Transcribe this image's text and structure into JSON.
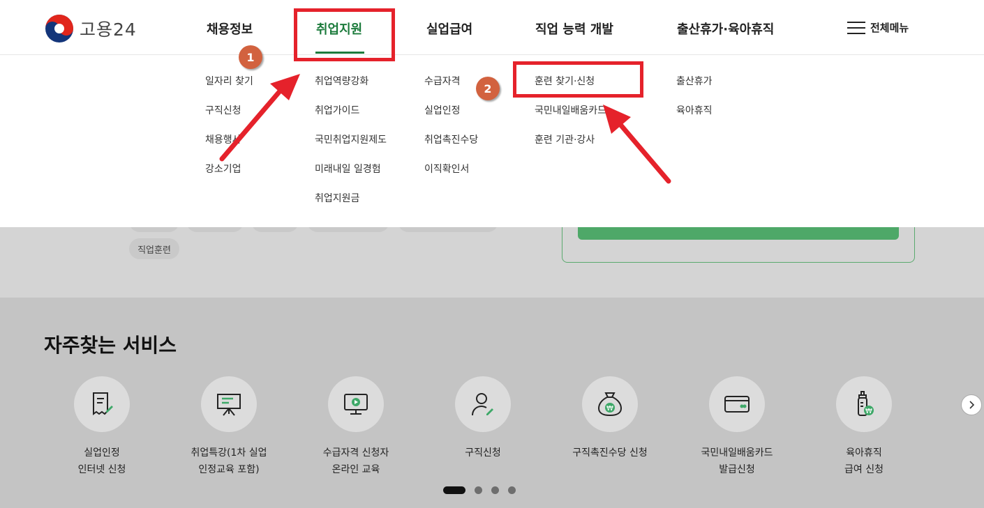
{
  "header": {
    "logo_text": "고용24",
    "gnb": [
      "채용정보",
      "취업지원",
      "실업급여",
      "직업 능력 개발",
      "출산휴가·육아휴직"
    ],
    "all_menu_label": "전체메뉴",
    "active_color": "#1c7b3c"
  },
  "dropdown": {
    "col1": [
      "일자리 찾기",
      "구직신청",
      "채용행사",
      "강소기업"
    ],
    "col2": [
      "취업역량강화",
      "취업가이드",
      "국민취업지원제도",
      "미래내일 일경험",
      "취업지원금"
    ],
    "col3": [
      "수급자격",
      "실업인정",
      "취업촉진수당",
      "이직확인서"
    ],
    "col4": [
      "훈련 찾기·신청",
      "국민내일배움카드",
      "훈련 기관·강사"
    ],
    "col5": [
      "출산휴가",
      "육아휴직"
    ]
  },
  "background": {
    "chip_label": "직업훈련"
  },
  "services": {
    "title": "자주찾는 서비스",
    "items": [
      {
        "icon": "document-pen-icon",
        "label": "실업인정\n인터넷 신청"
      },
      {
        "icon": "presentation-board-icon",
        "label": "취업특강(1차 실업\n인정교육 포함)"
      },
      {
        "icon": "monitor-play-icon",
        "label": "수급자격 신청자\n온라인 교육"
      },
      {
        "icon": "person-pen-icon",
        "label": "구직신청"
      },
      {
        "icon": "money-bag-won-icon",
        "label": "구직촉진수당 신청"
      },
      {
        "icon": "card-icon",
        "label": "국민내일배움카드\n발급신청"
      },
      {
        "icon": "baby-bottle-won-icon",
        "label": "육아휴직\n급여 신청"
      }
    ],
    "pagination_total": 4,
    "pagination_active": 1
  },
  "annotations": {
    "badge1": "1",
    "badge2": "2",
    "highlight_color": "#e5222b",
    "badge_color": "#d2623f"
  }
}
